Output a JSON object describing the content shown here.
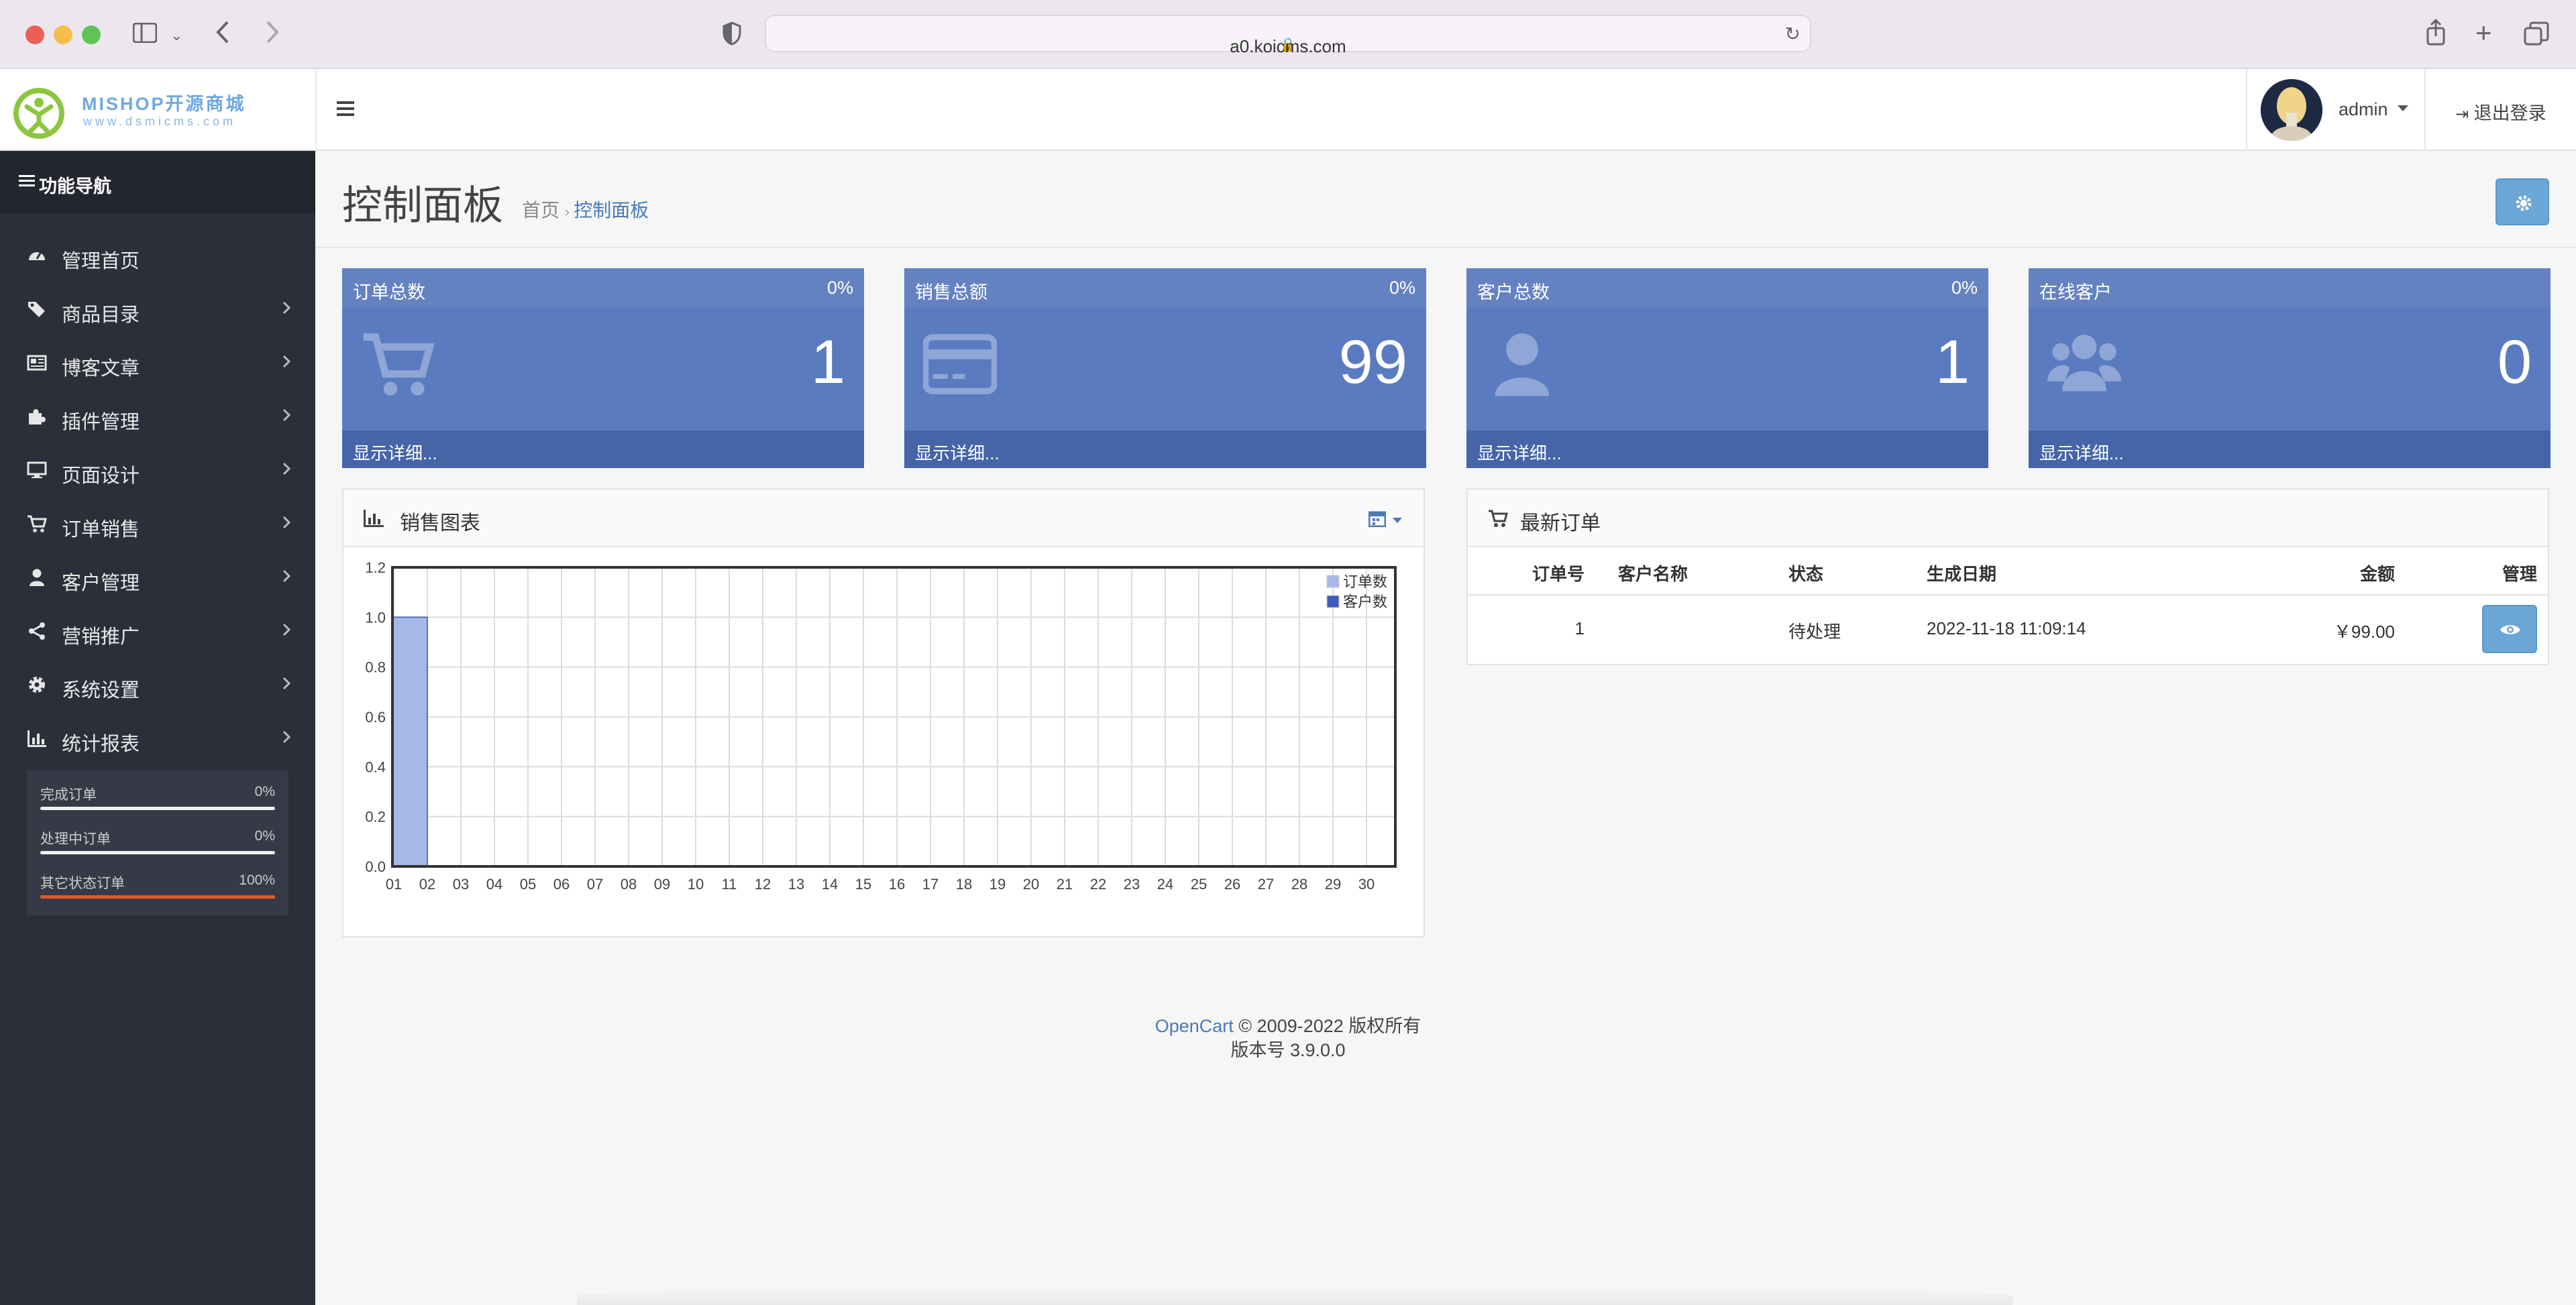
{
  "browser": {
    "url": "a0.koicms.com"
  },
  "header": {
    "logo_title": "MISHOP开源商城",
    "logo_sub": "www.dsmicms.com",
    "username": "admin",
    "logout": "退出登录"
  },
  "sidebar": {
    "title": "功能导航",
    "items": [
      {
        "label": "管理首页",
        "icon": "dashboard-icon",
        "chevron": false
      },
      {
        "label": "商品目录",
        "icon": "tags-icon",
        "chevron": true
      },
      {
        "label": "博客文章",
        "icon": "newspaper-icon",
        "chevron": true
      },
      {
        "label": "插件管理",
        "icon": "puzzle-icon",
        "chevron": true
      },
      {
        "label": "页面设计",
        "icon": "desktop-icon",
        "chevron": true
      },
      {
        "label": "订单销售",
        "icon": "cart-icon",
        "chevron": true
      },
      {
        "label": "客户管理",
        "icon": "user-icon",
        "chevron": true
      },
      {
        "label": "营销推广",
        "icon": "share-icon",
        "chevron": true
      },
      {
        "label": "系统设置",
        "icon": "gear-icon",
        "chevron": true
      },
      {
        "label": "统计报表",
        "icon": "bar-chart-icon",
        "chevron": true
      }
    ],
    "stats": [
      {
        "label": "完成订单",
        "value": "0%",
        "fill": 0
      },
      {
        "label": "处理中订单",
        "value": "0%",
        "fill": 0
      },
      {
        "label": "其它状态订单",
        "value": "100%",
        "fill": 100
      }
    ]
  },
  "page": {
    "title": "控制面板",
    "breadcrumb_home": "首页",
    "breadcrumb_current": "控制面板"
  },
  "tiles": [
    {
      "title": "订单总数",
      "percent": "0%",
      "value": "1",
      "icon": "cart-icon",
      "more": "显示详细..."
    },
    {
      "title": "销售总额",
      "percent": "0%",
      "value": "99",
      "icon": "credit-card-icon",
      "more": "显示详细..."
    },
    {
      "title": "客户总数",
      "percent": "0%",
      "value": "1",
      "icon": "user-icon",
      "more": "显示详细..."
    },
    {
      "title": "在线客户",
      "percent": "",
      "value": "0",
      "icon": "users-icon",
      "more": "显示详细..."
    }
  ],
  "sales_chart": {
    "title": "销售图表"
  },
  "chart_data": {
    "type": "bar",
    "title": "",
    "categories": [
      "01",
      "02",
      "03",
      "04",
      "05",
      "06",
      "07",
      "08",
      "09",
      "10",
      "11",
      "12",
      "13",
      "14",
      "15",
      "16",
      "17",
      "18",
      "19",
      "20",
      "21",
      "22",
      "23",
      "24",
      "25",
      "26",
      "27",
      "28",
      "29",
      "30"
    ],
    "series": [
      {
        "name": "订单数",
        "color": "#a6b8e8",
        "values": [
          1,
          0,
          0,
          0,
          0,
          0,
          0,
          0,
          0,
          0,
          0,
          0,
          0,
          0,
          0,
          0,
          0,
          0,
          0,
          0,
          0,
          0,
          0,
          0,
          0,
          0,
          0,
          0,
          0,
          0
        ]
      },
      {
        "name": "客户数",
        "color": "#3f5bbd",
        "values": [
          0,
          0,
          0,
          0,
          0,
          0,
          0,
          0,
          0,
          0,
          0,
          0,
          0,
          0,
          0,
          0,
          0,
          0,
          0,
          0,
          0,
          0,
          0,
          0,
          0,
          0,
          0,
          0,
          0,
          0
        ]
      }
    ],
    "yticks": [
      "0.0",
      "0.2",
      "0.4",
      "0.6",
      "0.8",
      "1.0",
      "1.2"
    ],
    "ylim": [
      0,
      1.2
    ],
    "grid": true,
    "legend": "top-right"
  },
  "orders": {
    "title": "最新订单",
    "columns": [
      "订单号",
      "客户名称",
      "状态",
      "生成日期",
      "金额",
      "管理"
    ],
    "rows": [
      {
        "id": "1",
        "customer": "",
        "status": "待处理",
        "date": "2022-11-18 11:09:14",
        "amount": "￥99.00"
      }
    ]
  },
  "footer": {
    "brand": "OpenCart",
    "copyright": "© 2009-2022 版权所有",
    "version": "版本号 3.9.0.0"
  },
  "colors": {
    "sidebar_bg": "#2b2f3a",
    "tile_bg": "#5a7bc0",
    "accent": "#4c7ab8"
  }
}
